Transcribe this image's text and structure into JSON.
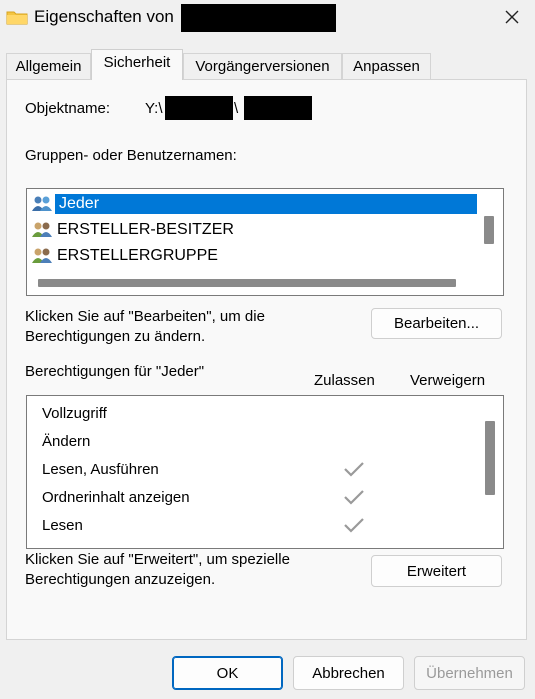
{
  "window": {
    "title": "Eigenschaften von",
    "close_icon": "close-icon"
  },
  "tabs": [
    {
      "label": "Allgemein",
      "active": false
    },
    {
      "label": "Sicherheit",
      "active": true
    },
    {
      "label": "Vorgängerversionen",
      "active": false
    },
    {
      "label": "Anpassen",
      "active": false
    }
  ],
  "object": {
    "label": "Objektname:",
    "path_prefix": "Y:\\",
    "separator": "\\"
  },
  "groups": {
    "label": "Gruppen- oder Benutzernamen:",
    "items": [
      {
        "name": "Jeder",
        "selected": true,
        "icon": "users-group-icon"
      },
      {
        "name": "ERSTELLER-BESITZER",
        "selected": false,
        "icon": "users-group-icon"
      },
      {
        "name": "ERSTELLERGRUPPE",
        "selected": false,
        "icon": "users-group-icon"
      }
    ]
  },
  "edit_hint": {
    "line1": "Klicken Sie auf \"Bearbeiten\", um die",
    "line2": "Berechtigungen zu ändern.",
    "button": "Bearbeiten..."
  },
  "permissions": {
    "label": "Berechtigungen für \"Jeder\"",
    "col_allow": "Zulassen",
    "col_deny": "Verweigern",
    "rows": [
      {
        "name": "Vollzugriff",
        "allow": false,
        "deny": false
      },
      {
        "name": "Ändern",
        "allow": false,
        "deny": false
      },
      {
        "name": "Lesen, Ausführen",
        "allow": true,
        "deny": false
      },
      {
        "name": "Ordnerinhalt anzeigen",
        "allow": true,
        "deny": false
      },
      {
        "name": "Lesen",
        "allow": true,
        "deny": false
      }
    ]
  },
  "advanced_hint": {
    "line1": "Klicken Sie auf \"Erweitert\", um spezielle",
    "line2": "Berechtigungen anzuzeigen.",
    "button": "Erweitert"
  },
  "footer": {
    "ok": "OK",
    "cancel": "Abbrechen",
    "apply": "Übernehmen"
  },
  "colors": {
    "selection": "#0078d7",
    "primary_border": "#0067c0",
    "check": "#9a9a9a"
  }
}
